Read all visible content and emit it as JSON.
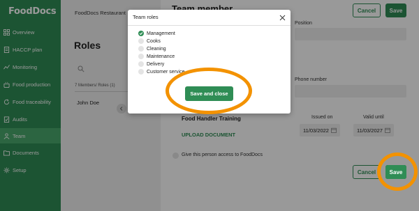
{
  "app": {
    "logo": "FoodDocs"
  },
  "sidebar": {
    "items": [
      {
        "label": "Overview",
        "icon": "grid-icon"
      },
      {
        "label": "HACCP plan",
        "icon": "document-icon"
      },
      {
        "label": "Monitoring",
        "icon": "chart-icon"
      },
      {
        "label": "Food production",
        "icon": "pot-icon"
      },
      {
        "label": "Food traceability",
        "icon": "refresh-icon"
      },
      {
        "label": "Audits",
        "icon": "audit-icon"
      },
      {
        "label": "Team",
        "icon": "person-icon",
        "active": true
      },
      {
        "label": "Documents",
        "icon": "folder-icon"
      },
      {
        "label": "Setup",
        "icon": "gear-icon"
      }
    ]
  },
  "roles_panel": {
    "restaurant": "FoodDocs Restaurant",
    "title": "Roles",
    "column_header": "7 Members/ Roles (1)",
    "members": [
      {
        "name": "John Doe"
      }
    ]
  },
  "team_member": {
    "title": "Team member",
    "cancel_label": "Cancel",
    "save_label": "Save",
    "position_label": "Position",
    "phone_label": "Phone number",
    "training_name": "Food Handler Training",
    "upload_label": "UPLOAD DOCUMENT",
    "issued_label": "Issued on",
    "valid_label": "Valid until",
    "issued_value": "11/03/2022",
    "valid_value": "11/03/2027",
    "access_label": "Give this person access to FoodDocs"
  },
  "modal": {
    "title": "Team roles",
    "roles": [
      {
        "label": "Management",
        "checked": true
      },
      {
        "label": "Cooks",
        "checked": false
      },
      {
        "label": "Cleaning",
        "checked": false
      },
      {
        "label": "Maintenance",
        "checked": false
      },
      {
        "label": "Delivery",
        "checked": false
      },
      {
        "label": "Customer service",
        "checked": false
      }
    ],
    "save_close_label": "Save and close"
  },
  "colors": {
    "brand_green": "#2f8d55",
    "highlight_orange": "#f39200"
  }
}
